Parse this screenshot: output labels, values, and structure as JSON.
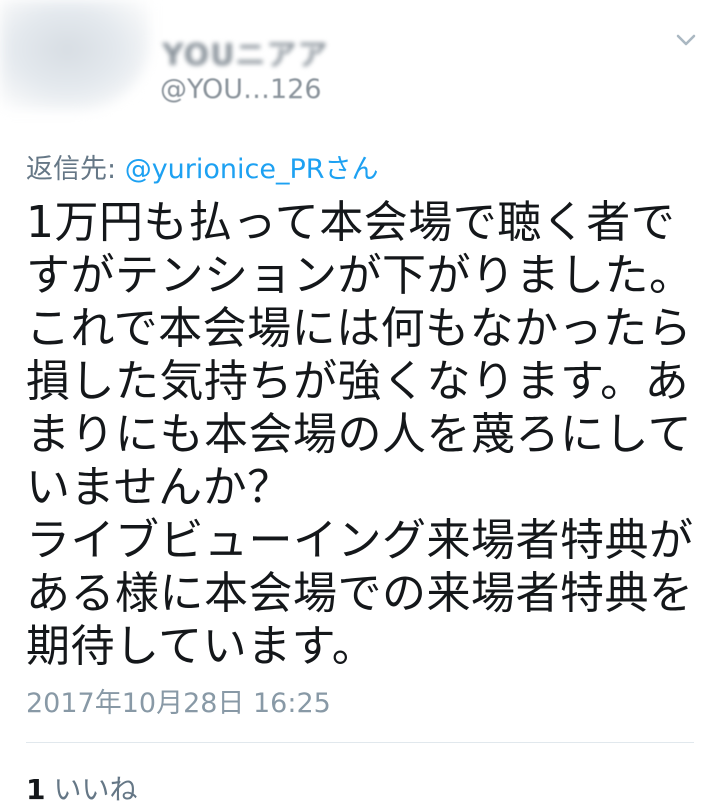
{
  "tweet": {
    "author": {
      "display_name": "YOUニアア",
      "handle": "@YOU…126"
    },
    "reply_to": {
      "prefix": "返信先: ",
      "mention": "@yurionice_PR",
      "suffix": "さん"
    },
    "text": "1万円も払って本会場で聴く者で\nすがテンションが下がりました。\nこれで本会場には何もなかったら\n損した気持ちが強くなります。あ\nまりにも本会場の人を蔑ろにして\nいませんか？\nライブビューイング来場者特典が\nある様に本会場での来場者特典を\n期待しています。",
    "timestamp": "2017年10月28日 16:25",
    "likes": {
      "count": "1",
      "label": "いいね"
    }
  },
  "icons": {
    "menu": "chevron-down-icon"
  },
  "colors": {
    "text": "#14171a",
    "secondary": "#657786",
    "link": "#1da1f2",
    "divider": "#e1e8ed"
  }
}
